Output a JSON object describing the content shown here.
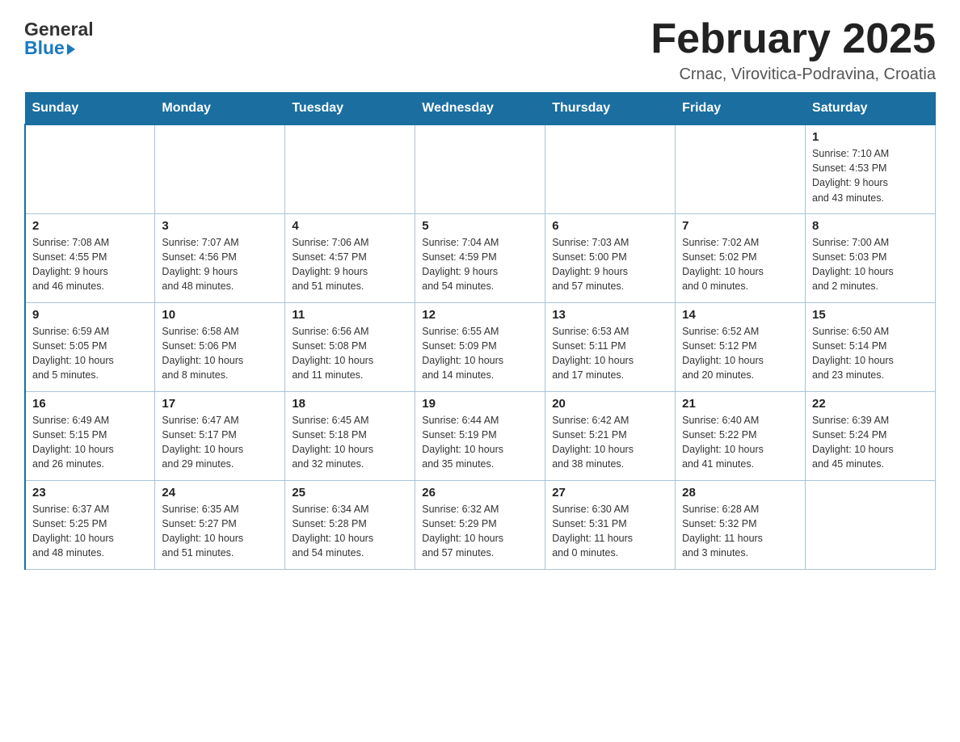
{
  "header": {
    "logo_line1": "General",
    "logo_line2": "Blue",
    "title": "February 2025",
    "subtitle": "Crnac, Virovitica-Podravina, Croatia"
  },
  "calendar": {
    "days_of_week": [
      "Sunday",
      "Monday",
      "Tuesday",
      "Wednesday",
      "Thursday",
      "Friday",
      "Saturday"
    ],
    "weeks": [
      [
        {
          "day": "",
          "info": ""
        },
        {
          "day": "",
          "info": ""
        },
        {
          "day": "",
          "info": ""
        },
        {
          "day": "",
          "info": ""
        },
        {
          "day": "",
          "info": ""
        },
        {
          "day": "",
          "info": ""
        },
        {
          "day": "1",
          "info": "Sunrise: 7:10 AM\nSunset: 4:53 PM\nDaylight: 9 hours\nand 43 minutes."
        }
      ],
      [
        {
          "day": "2",
          "info": "Sunrise: 7:08 AM\nSunset: 4:55 PM\nDaylight: 9 hours\nand 46 minutes."
        },
        {
          "day": "3",
          "info": "Sunrise: 7:07 AM\nSunset: 4:56 PM\nDaylight: 9 hours\nand 48 minutes."
        },
        {
          "day": "4",
          "info": "Sunrise: 7:06 AM\nSunset: 4:57 PM\nDaylight: 9 hours\nand 51 minutes."
        },
        {
          "day": "5",
          "info": "Sunrise: 7:04 AM\nSunset: 4:59 PM\nDaylight: 9 hours\nand 54 minutes."
        },
        {
          "day": "6",
          "info": "Sunrise: 7:03 AM\nSunset: 5:00 PM\nDaylight: 9 hours\nand 57 minutes."
        },
        {
          "day": "7",
          "info": "Sunrise: 7:02 AM\nSunset: 5:02 PM\nDaylight: 10 hours\nand 0 minutes."
        },
        {
          "day": "8",
          "info": "Sunrise: 7:00 AM\nSunset: 5:03 PM\nDaylight: 10 hours\nand 2 minutes."
        }
      ],
      [
        {
          "day": "9",
          "info": "Sunrise: 6:59 AM\nSunset: 5:05 PM\nDaylight: 10 hours\nand 5 minutes."
        },
        {
          "day": "10",
          "info": "Sunrise: 6:58 AM\nSunset: 5:06 PM\nDaylight: 10 hours\nand 8 minutes."
        },
        {
          "day": "11",
          "info": "Sunrise: 6:56 AM\nSunset: 5:08 PM\nDaylight: 10 hours\nand 11 minutes."
        },
        {
          "day": "12",
          "info": "Sunrise: 6:55 AM\nSunset: 5:09 PM\nDaylight: 10 hours\nand 14 minutes."
        },
        {
          "day": "13",
          "info": "Sunrise: 6:53 AM\nSunset: 5:11 PM\nDaylight: 10 hours\nand 17 minutes."
        },
        {
          "day": "14",
          "info": "Sunrise: 6:52 AM\nSunset: 5:12 PM\nDaylight: 10 hours\nand 20 minutes."
        },
        {
          "day": "15",
          "info": "Sunrise: 6:50 AM\nSunset: 5:14 PM\nDaylight: 10 hours\nand 23 minutes."
        }
      ],
      [
        {
          "day": "16",
          "info": "Sunrise: 6:49 AM\nSunset: 5:15 PM\nDaylight: 10 hours\nand 26 minutes."
        },
        {
          "day": "17",
          "info": "Sunrise: 6:47 AM\nSunset: 5:17 PM\nDaylight: 10 hours\nand 29 minutes."
        },
        {
          "day": "18",
          "info": "Sunrise: 6:45 AM\nSunset: 5:18 PM\nDaylight: 10 hours\nand 32 minutes."
        },
        {
          "day": "19",
          "info": "Sunrise: 6:44 AM\nSunset: 5:19 PM\nDaylight: 10 hours\nand 35 minutes."
        },
        {
          "day": "20",
          "info": "Sunrise: 6:42 AM\nSunset: 5:21 PM\nDaylight: 10 hours\nand 38 minutes."
        },
        {
          "day": "21",
          "info": "Sunrise: 6:40 AM\nSunset: 5:22 PM\nDaylight: 10 hours\nand 41 minutes."
        },
        {
          "day": "22",
          "info": "Sunrise: 6:39 AM\nSunset: 5:24 PM\nDaylight: 10 hours\nand 45 minutes."
        }
      ],
      [
        {
          "day": "23",
          "info": "Sunrise: 6:37 AM\nSunset: 5:25 PM\nDaylight: 10 hours\nand 48 minutes."
        },
        {
          "day": "24",
          "info": "Sunrise: 6:35 AM\nSunset: 5:27 PM\nDaylight: 10 hours\nand 51 minutes."
        },
        {
          "day": "25",
          "info": "Sunrise: 6:34 AM\nSunset: 5:28 PM\nDaylight: 10 hours\nand 54 minutes."
        },
        {
          "day": "26",
          "info": "Sunrise: 6:32 AM\nSunset: 5:29 PM\nDaylight: 10 hours\nand 57 minutes."
        },
        {
          "day": "27",
          "info": "Sunrise: 6:30 AM\nSunset: 5:31 PM\nDaylight: 11 hours\nand 0 minutes."
        },
        {
          "day": "28",
          "info": "Sunrise: 6:28 AM\nSunset: 5:32 PM\nDaylight: 11 hours\nand 3 minutes."
        },
        {
          "day": "",
          "info": ""
        }
      ]
    ]
  }
}
